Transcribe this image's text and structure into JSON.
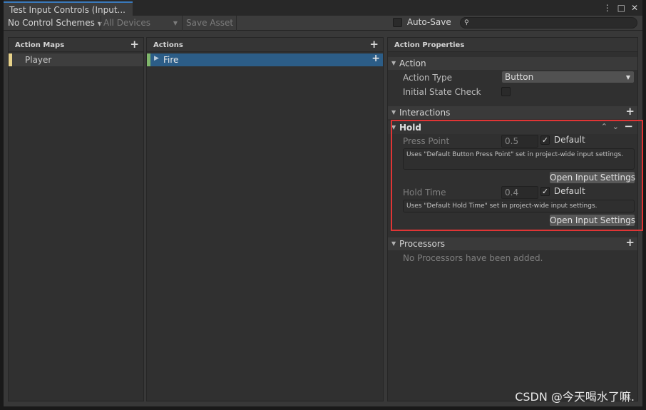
{
  "window": {
    "tab_title": "Test Input Controls (Input...",
    "icons": {
      "menu": "⋮",
      "maximize": "□",
      "close": "✕"
    }
  },
  "toolbar": {
    "control_schemes": "No Control Schemes",
    "all_devices": "All Devices",
    "save_asset": "Save Asset",
    "auto_save_label": "Auto-Save",
    "auto_save_checked": false,
    "search_icon": "search-icon",
    "search_value": ""
  },
  "action_maps": {
    "header": "Action Maps",
    "items": [
      {
        "label": "Player",
        "color": "#e7d28a"
      }
    ]
  },
  "actions": {
    "header": "Actions",
    "items": [
      {
        "label": "Fire",
        "color": "#7fb66b",
        "selected": true
      }
    ]
  },
  "properties": {
    "header": "Action Properties",
    "action_section": "Action",
    "action_type_label": "Action Type",
    "action_type_value": "Button",
    "initial_state_label": "Initial State Check",
    "interactions_section": "Interactions",
    "hold": {
      "title": "Hold",
      "press_point_label": "Press Point",
      "press_point_value": "0.5",
      "press_default_label": "Default",
      "press_help": "Uses \"Default Button Press Point\" set in project-wide input settings.",
      "open_settings_1": "Open Input Settings",
      "hold_time_label": "Hold Time",
      "hold_time_value": "0.4",
      "hold_default_label": "Default",
      "hold_help": "Uses \"Default Hold Time\" set in project-wide input settings.",
      "open_settings_2": "Open Input Settings"
    },
    "processors_section": "Processors",
    "processors_empty": "No Processors have been added."
  },
  "watermark": "CSDN @今天喝水了嘛."
}
